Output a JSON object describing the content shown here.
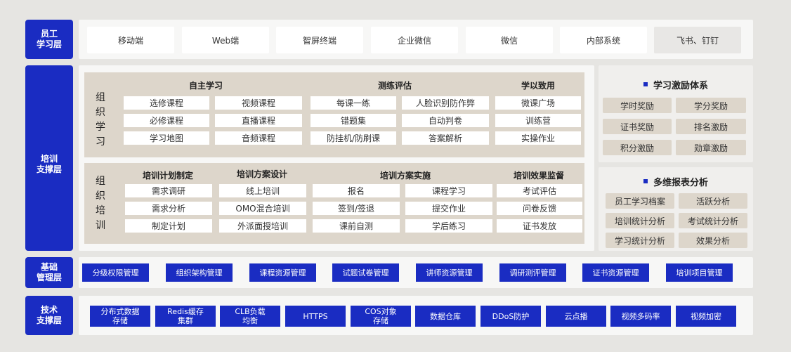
{
  "layers": {
    "employee": "员工\n学习层",
    "training": "培训\n支撑层",
    "base": "基础\n管理层",
    "tech": "技术\n支撑层"
  },
  "employee_items": [
    "移动端",
    "Web端",
    "智屏终端",
    "企业微信",
    "微信",
    "内部系统",
    "飞书、钉钉"
  ],
  "org_learning": {
    "label": "组\n织\n学\n习",
    "groups": [
      {
        "title": "自主学习",
        "items": [
          "选修课程",
          "视频课程",
          "必修课程",
          "直播课程",
          "学习地图",
          "音频课程"
        ]
      },
      {
        "title": "测练评估",
        "items": [
          "每课一练",
          "人脸识别防作弊",
          "错题集",
          "自动判卷",
          "防挂机/防刷课",
          "答案解析"
        ]
      },
      {
        "title": "学以致用",
        "items": [
          "微课广场",
          "训练营",
          "实操作业"
        ]
      }
    ]
  },
  "org_training": {
    "label": "组\n织\n培\n训",
    "groups": [
      {
        "title": "培训计划制定",
        "items": [
          "需求调研",
          "需求分析",
          "制定计划"
        ]
      },
      {
        "title": "培训方案设计",
        "items": [
          "线上培训",
          "OMO混合培训",
          "外派面授培训"
        ]
      },
      {
        "title": "培训方案实施",
        "items": [
          "报名",
          "课程学习",
          "签到/签退",
          "提交作业",
          "课前自测",
          "学后练习"
        ]
      },
      {
        "title": "培训效果监督",
        "items": [
          "考试评估",
          "问卷反馈",
          "证书发放"
        ]
      }
    ]
  },
  "incentive": {
    "title": "学习激励体系",
    "items": [
      "学时奖励",
      "学分奖励",
      "证书奖励",
      "排名激励",
      "积分激励",
      "勋章激励"
    ]
  },
  "reports": {
    "title": "多维报表分析",
    "items": [
      "员工学习档案",
      "活跃分析",
      "培训统计分析",
      "考试统计分析",
      "学习统计分析",
      "效果分析"
    ]
  },
  "base_items": [
    "分级权限管理",
    "组织架构管理",
    "课程资源管理",
    "试题试卷管理",
    "讲师资源管理",
    "调研测评管理",
    "证书资源管理",
    "培训项目管理"
  ],
  "tech_items": [
    "分布式数据\n存储",
    "Redis缓存\n集群",
    "CLB负载\n均衡",
    "HTTPS",
    "COS对象\n存储",
    "数据仓库",
    "DDoS防护",
    "云点播",
    "视频多码率",
    "视频加密"
  ],
  "colors": {
    "accent": "#1a2cc2",
    "beige": "#ddd6cb",
    "background": "#e6e5e2"
  }
}
